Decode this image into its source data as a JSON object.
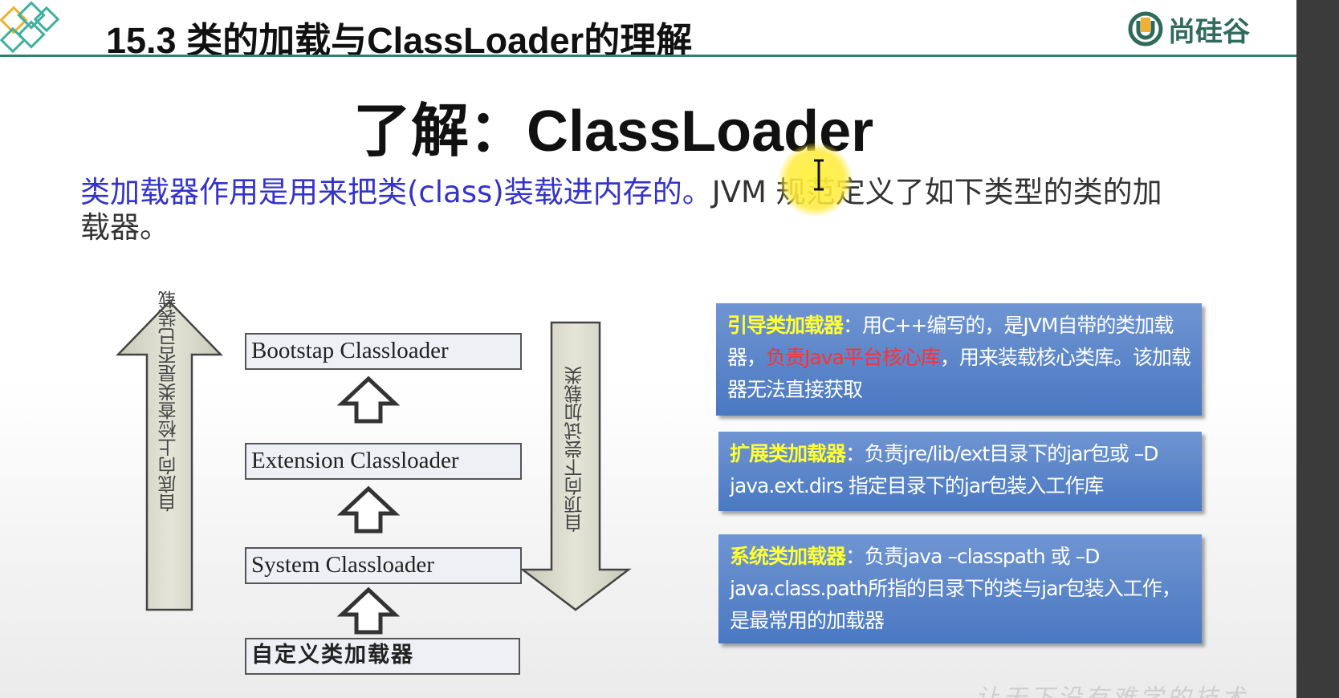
{
  "header": {
    "title": "15.3 类的加载与ClassLoader的理解",
    "brand": "尚硅谷"
  },
  "slide": {
    "main_title": "了解：ClassLoader",
    "paragraph_blue": "类加载器作用是用来把类(class)装载进内存的。",
    "paragraph_rest": "JVM 规范定义了如下类型的类的加载器。"
  },
  "diagram": {
    "up_arrow_label": "自底向上检查类是否已装载",
    "down_arrow_label": "自顶向下尝试加载类",
    "loaders": [
      "Bootstap Classloader",
      "Extension Classloader",
      "System Classloader",
      "自定义类加载器"
    ]
  },
  "info": {
    "bootstrap": {
      "name": "引导类加载器",
      "desc1": "：用C++编写的，是JVM自带的类加载器，",
      "highlight": "负责Java平台核心库",
      "desc2": "，用来装载核心类库。该加载器无法直接获取"
    },
    "extension": {
      "name": "扩展类加载器",
      "desc": "：负责jre/lib/ext目录下的jar包或 –D java.ext.dirs 指定目录下的jar包装入工作库"
    },
    "system": {
      "name": "系统类加载器",
      "desc": "：负责java –classpath 或 –D java.class.path所指的目录下的类与jar包装入工作，是最常用的加载器"
    }
  },
  "footer": {
    "watermark": "让天下没有难学的技术"
  },
  "colors": {
    "header_line": "#2f7f6e",
    "paragraph_blue": "#3333cc",
    "info_box": "#5a86c8",
    "info_highlight": "#ffff33",
    "info_red": "#ff3030"
  }
}
